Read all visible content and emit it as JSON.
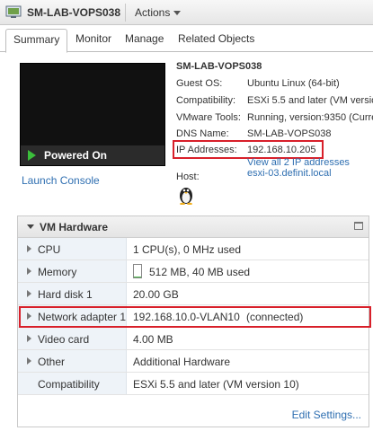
{
  "header": {
    "vm_name": "SM-LAB-VOPS038",
    "actions_label": "Actions"
  },
  "tabs": [
    {
      "label": "Summary",
      "active": true
    },
    {
      "label": "Monitor"
    },
    {
      "label": "Manage"
    },
    {
      "label": "Related Objects"
    }
  ],
  "console": {
    "power_state": "Powered On",
    "launch_label": "Launch Console"
  },
  "summary": {
    "vm_name": "SM-LAB-VOPS038",
    "fields": [
      {
        "label": "Guest OS:",
        "value": "Ubuntu Linux (64-bit)"
      },
      {
        "label": "Compatibility:",
        "value": "ESXi 5.5 and later (VM version"
      },
      {
        "label": "VMware Tools:",
        "value": "Running, version:9350 (Curren"
      },
      {
        "label": "DNS Name:",
        "value": "SM-LAB-VOPS038"
      },
      {
        "label": "IP Addresses:",
        "value": "192.168.10.205"
      }
    ],
    "ip_view_all": "View all 2 IP addresses",
    "host_label": "Host:",
    "host_value": "esxi-03.definit.local"
  },
  "hardware": {
    "title": "VM Hardware",
    "rows": [
      {
        "label": "CPU",
        "value": "1 CPU(s), 0 MHz used",
        "expandable": true
      },
      {
        "label": "Memory",
        "value": "512 MB, 40 MB used",
        "expandable": true,
        "usage_fraction": 0.08
      },
      {
        "label": "Hard disk 1",
        "value": "20.00 GB",
        "expandable": true
      },
      {
        "label": "Network adapter 1",
        "value_link": "192.168.10.0-VLAN10",
        "value_status": "(connected)",
        "expandable": true
      },
      {
        "label": "Video card",
        "value": "4.00 MB",
        "expandable": true
      },
      {
        "label": "Other",
        "value": "Additional Hardware",
        "expandable": true
      },
      {
        "label": "Compatibility",
        "value": "ESXi 5.5 and later (VM version 10)",
        "expandable": false
      }
    ],
    "edit_label": "Edit Settings..."
  },
  "colors": {
    "highlight": "#d8202a",
    "link": "#2f6fb1",
    "power_on": "#3bbf3b"
  }
}
